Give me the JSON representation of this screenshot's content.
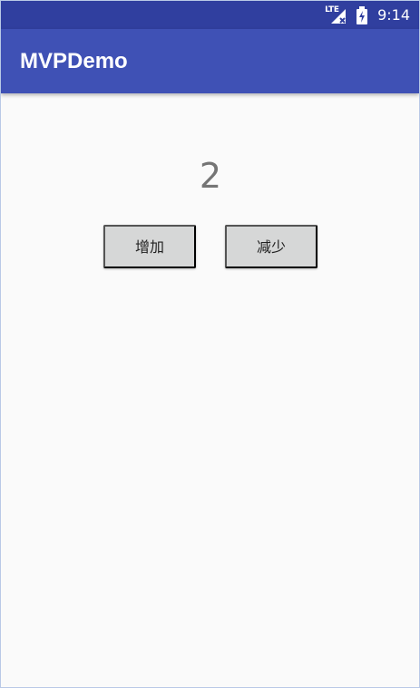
{
  "status_bar": {
    "network": "LTE",
    "time": "9:14",
    "icons": [
      "signal-icon",
      "battery-icon"
    ]
  },
  "app_bar": {
    "title": "MVPDemo"
  },
  "main": {
    "counter_value": "2",
    "buttons": {
      "increase_label": "增加",
      "decrease_label": "减少"
    }
  },
  "colors": {
    "status_bar": "#303f9f",
    "app_bar": "#3f51b5",
    "background": "#fafafa",
    "button": "#d6d7d7",
    "counter_text": "#757575"
  }
}
